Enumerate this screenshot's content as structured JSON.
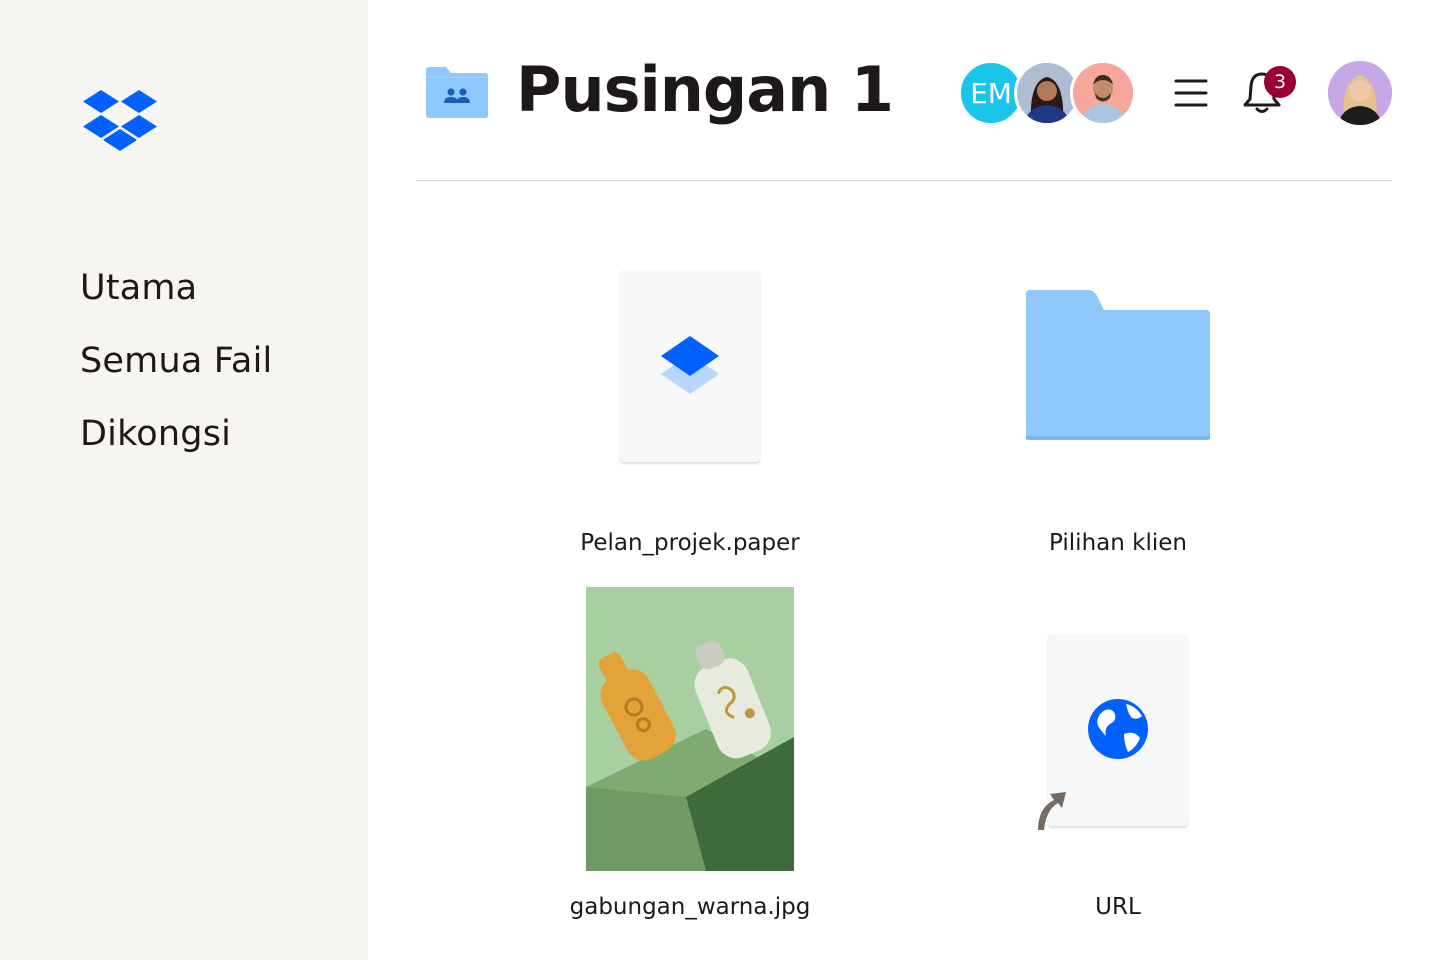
{
  "sidebar": {
    "logo_icon": "dropbox-logo",
    "items": [
      {
        "label": "Utama"
      },
      {
        "label": "Semua Fail"
      },
      {
        "label": "Dikongsi"
      }
    ]
  },
  "header": {
    "folder_icon": "shared-folder-icon",
    "title": "Pusingan 1",
    "members": [
      {
        "initials": "EM",
        "color": "#19c5e8"
      },
      {
        "initials": "",
        "color": "#a9b9cf"
      },
      {
        "initials": "",
        "color": "#f7a9a0"
      }
    ],
    "menu_icon": "hamburger-menu-icon",
    "notifications": {
      "icon": "bell-icon",
      "count": "3",
      "badge_color": "#9b0032"
    },
    "user_avatar_color": "#c8a6e6"
  },
  "files": [
    {
      "name": "Pelan_projek.paper",
      "type": "paper-doc"
    },
    {
      "name": "Pilihan klien",
      "type": "folder"
    },
    {
      "name": "gabungan_warna.jpg",
      "type": "image"
    },
    {
      "name": "URL",
      "type": "web-link"
    }
  ],
  "colors": {
    "brand_blue": "#0061fe",
    "folder_blue": "#8ec8fd",
    "sidebar_bg": "#f7f5f2",
    "text": "#1e1919"
  }
}
